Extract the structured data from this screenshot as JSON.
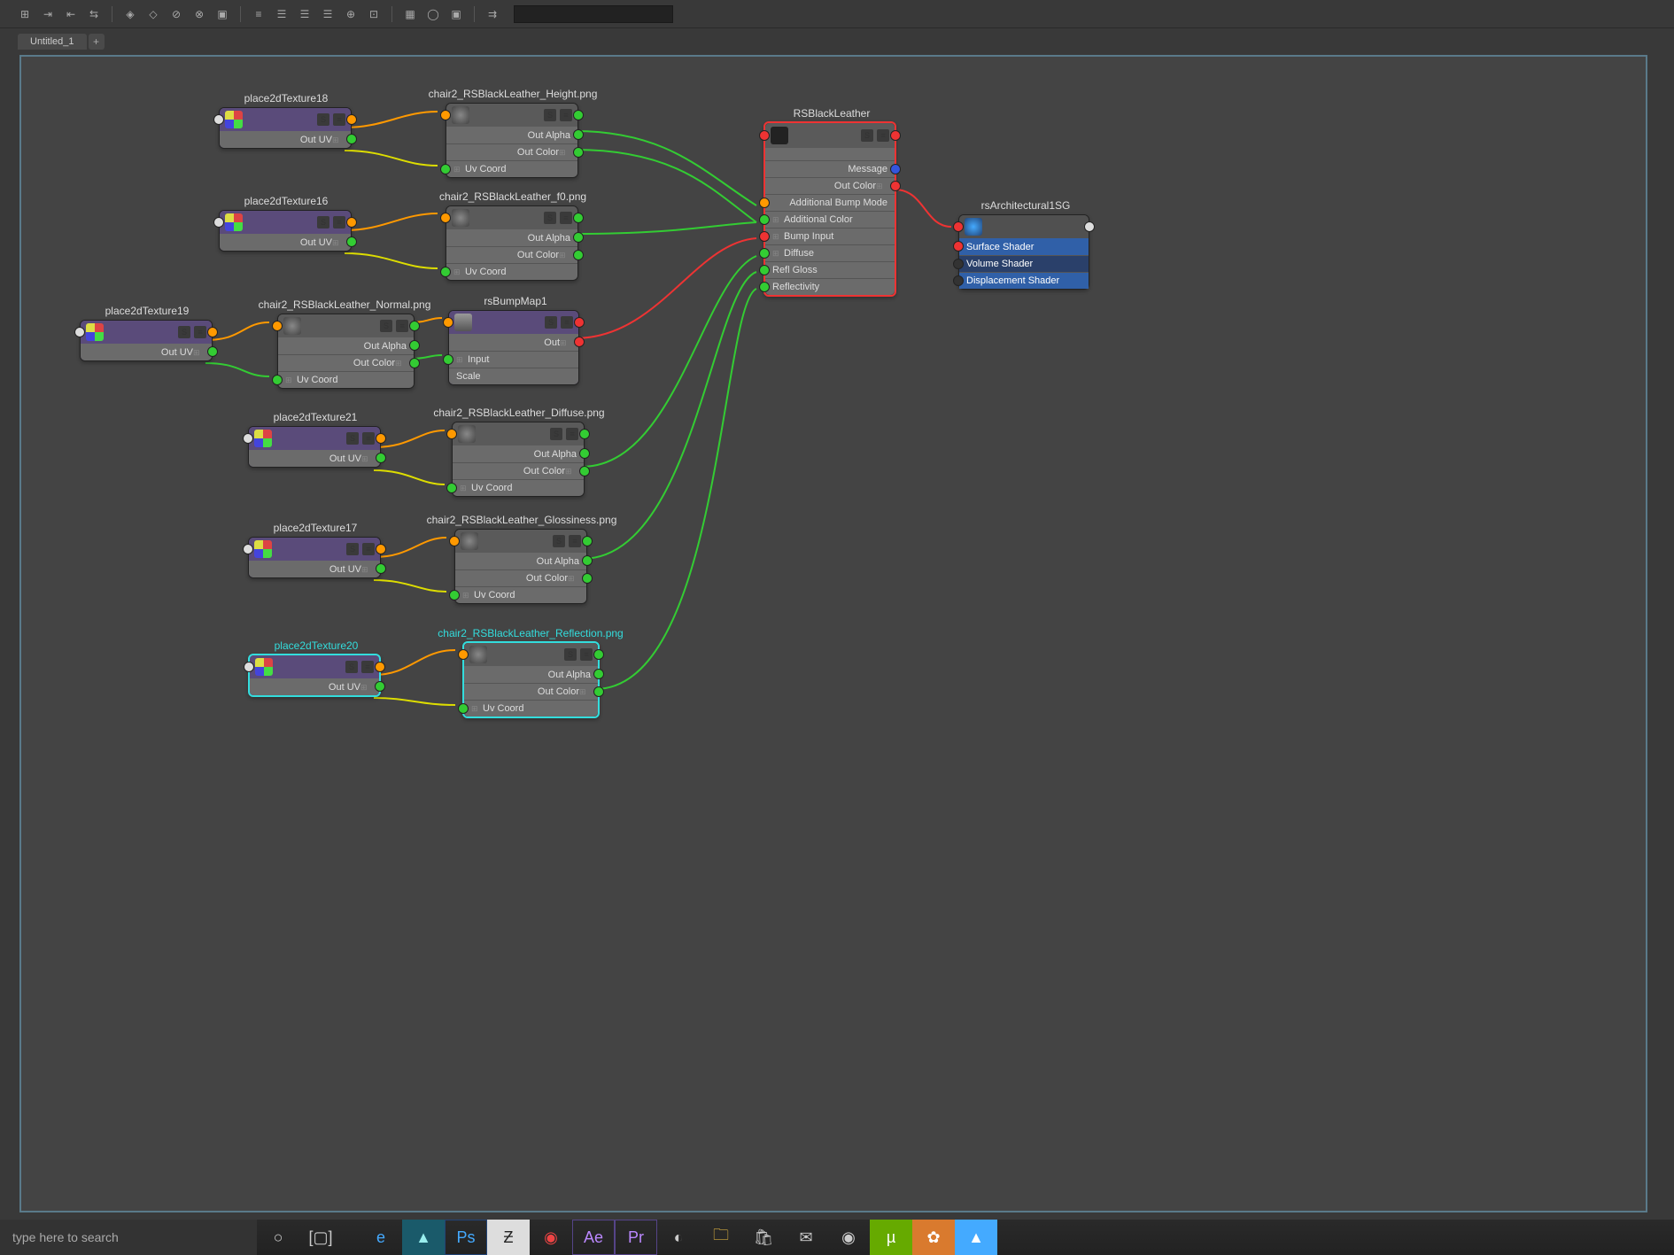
{
  "tab": {
    "name": "Untitled_1"
  },
  "search_placeholder": "type here to search",
  "nodes": {
    "p18": {
      "title": "place2dTexture18",
      "outuv": "Out UV"
    },
    "p16": {
      "title": "place2dTexture16",
      "outuv": "Out UV"
    },
    "p19": {
      "title": "place2dTexture19",
      "outuv": "Out UV"
    },
    "p21": {
      "title": "place2dTexture21",
      "outuv": "Out UV"
    },
    "p17": {
      "title": "place2dTexture17",
      "outuv": "Out UV"
    },
    "p20": {
      "title": "place2dTexture20",
      "outuv": "Out UV"
    },
    "height": {
      "title": "chair2_RSBlackLeather_Height.png",
      "outalpha": "Out Alpha",
      "outcolor": "Out Color",
      "uvcoord": "Uv Coord"
    },
    "f0": {
      "title": "chair2_RSBlackLeather_f0.png",
      "outalpha": "Out Alpha",
      "outcolor": "Out Color",
      "uvcoord": "Uv Coord"
    },
    "normal": {
      "title": "chair2_RSBlackLeather_Normal.png",
      "outalpha": "Out Alpha",
      "outcolor": "Out Color",
      "uvcoord": "Uv Coord"
    },
    "bump": {
      "title": "rsBumpMap1",
      "out": "Out",
      "input": "Input",
      "scale": "Scale"
    },
    "diffuse": {
      "title": "chair2_RSBlackLeather_Diffuse.png",
      "outalpha": "Out Alpha",
      "outcolor": "Out Color",
      "uvcoord": "Uv Coord"
    },
    "gloss": {
      "title": "chair2_RSBlackLeather_Glossiness.png",
      "outalpha": "Out Alpha",
      "outcolor": "Out Color",
      "uvcoord": "Uv Coord"
    },
    "refl": {
      "title": "chair2_RSBlackLeather_Reflection.png",
      "outalpha": "Out Alpha",
      "outcolor": "Out Color",
      "uvcoord": "Uv Coord"
    },
    "mat": {
      "title": "RSBlackLeather",
      "message": "Message",
      "outcolor": "Out Color",
      "abm": "Additional Bump Mode",
      "ac": "Additional Color",
      "bi": "Bump Input",
      "diff": "Diffuse",
      "rg": "Refl Gloss",
      "reflc": "Reflectivity"
    },
    "sg": {
      "title": "rsArchitectural1SG",
      "surf": "Surface Shader",
      "vol": "Volume Shader",
      "disp": "Displacement Shader"
    }
  }
}
